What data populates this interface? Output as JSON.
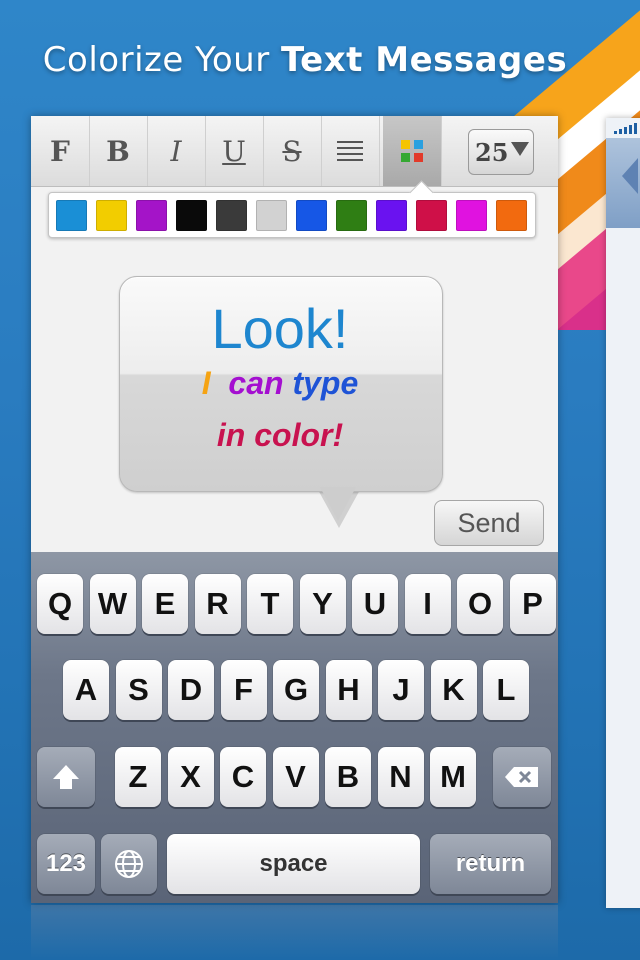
{
  "headline": {
    "light": "Colorize Your ",
    "bold": "Text Messages"
  },
  "toolbar": {
    "font": "F",
    "bold": "B",
    "italic": "I",
    "underline": "U",
    "strike": "S",
    "align_icon": "align-lines-icon",
    "color_icon": "color-grid-icon",
    "size_value": "25"
  },
  "palette": [
    "#1a8fd6",
    "#f2cd00",
    "#a414c8",
    "#0a0a0a",
    "#3a3a3a",
    "#d2d2d2",
    "#1657e6",
    "#2f7e14",
    "#6a12f0",
    "#cf1048",
    "#e012e0",
    "#f26a0f"
  ],
  "message": {
    "line1": "Look!",
    "line2_i": "I",
    "line2_rest_a": "can",
    "line2_rest_b": "type",
    "line3": "in color!",
    "colors": {
      "i": "#f5a313",
      "can": "#a40fd0",
      "type": "#1e53d6"
    }
  },
  "send_label": "Send",
  "keyboard": {
    "row1": [
      "Q",
      "W",
      "E",
      "R",
      "T",
      "Y",
      "U",
      "I",
      "O",
      "P"
    ],
    "row2": [
      "A",
      "S",
      "D",
      "F",
      "G",
      "H",
      "J",
      "K",
      "L"
    ],
    "row3": [
      "Z",
      "X",
      "C",
      "V",
      "B",
      "N",
      "M"
    ],
    "numbers": "123",
    "space": "space",
    "return": "return"
  }
}
